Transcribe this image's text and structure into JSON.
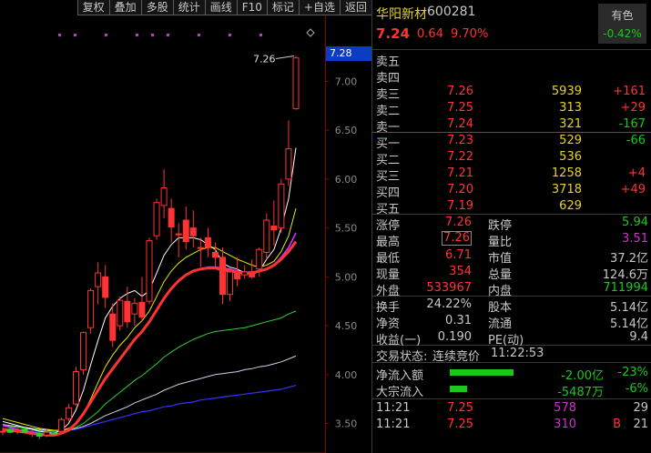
{
  "toolbar": {
    "buttons": [
      "复权",
      "叠加",
      "多股",
      "统计",
      "画线",
      "F10",
      "标记",
      "+自选",
      "返回"
    ]
  },
  "chart": {
    "high_label": "7.26",
    "current_price_tag": "7.28",
    "y_ticks": [
      "7.00",
      "6.50",
      "6.00",
      "5.50",
      "5.00",
      "4.50",
      "4.00",
      "3.50"
    ],
    "colors": {
      "up": "#ff3333",
      "down": "#00c8c8",
      "grid": "#5a0000",
      "ma_white": "#ffffff",
      "ma_yellow": "#e8e800",
      "ma_purple": "#cc33ff",
      "ma_green": "#33cc33",
      "ma_blue": "#3333ff",
      "tag": "#0b3cc4"
    }
  },
  "chart_data": {
    "type": "candlestick",
    "ylim": [
      3.3,
      7.6
    ],
    "candles": [
      {
        "o": 3.42,
        "h": 3.46,
        "l": 3.38,
        "c": 3.42
      },
      {
        "o": 3.44,
        "h": 3.46,
        "l": 3.4,
        "c": 3.41
      },
      {
        "o": 3.42,
        "h": 3.45,
        "l": 3.39,
        "c": 3.43
      },
      {
        "o": 3.44,
        "h": 3.46,
        "l": 3.4,
        "c": 3.41
      },
      {
        "o": 3.4,
        "h": 3.43,
        "l": 3.36,
        "c": 3.4
      },
      {
        "o": 3.4,
        "h": 3.42,
        "l": 3.34,
        "c": 3.37
      },
      {
        "o": 3.38,
        "h": 3.44,
        "l": 3.36,
        "c": 3.41
      },
      {
        "o": 3.4,
        "h": 3.43,
        "l": 3.38,
        "c": 3.39
      },
      {
        "o": 3.42,
        "h": 3.56,
        "l": 3.4,
        "c": 3.54
      },
      {
        "o": 3.55,
        "h": 3.7,
        "l": 3.52,
        "c": 3.66
      },
      {
        "o": 3.7,
        "h": 4.08,
        "l": 3.68,
        "c": 4.03
      },
      {
        "o": 4.05,
        "h": 4.44,
        "l": 4.0,
        "c": 4.43
      },
      {
        "o": 4.48,
        "h": 4.88,
        "l": 4.42,
        "c": 4.86
      },
      {
        "o": 4.9,
        "h": 5.15,
        "l": 4.72,
        "c": 5.04
      },
      {
        "o": 5.0,
        "h": 5.12,
        "l": 4.68,
        "c": 4.79
      },
      {
        "o": 4.62,
        "h": 4.73,
        "l": 4.28,
        "c": 4.35
      },
      {
        "o": 4.5,
        "h": 4.8,
        "l": 4.45,
        "c": 4.76
      },
      {
        "o": 4.75,
        "h": 4.9,
        "l": 4.48,
        "c": 4.54
      },
      {
        "o": 4.62,
        "h": 4.78,
        "l": 4.5,
        "c": 4.73
      },
      {
        "o": 4.74,
        "h": 5.0,
        "l": 4.55,
        "c": 4.59
      },
      {
        "o": 4.75,
        "h": 5.4,
        "l": 4.72,
        "c": 5.37
      },
      {
        "o": 5.42,
        "h": 5.8,
        "l": 5.38,
        "c": 5.76
      },
      {
        "o": 5.73,
        "h": 6.1,
        "l": 5.6,
        "c": 5.91
      },
      {
        "o": 5.7,
        "h": 5.8,
        "l": 5.35,
        "c": 5.51
      },
      {
        "o": 5.44,
        "h": 5.55,
        "l": 5.2,
        "c": 5.43
      },
      {
        "o": 5.58,
        "h": 5.72,
        "l": 5.28,
        "c": 5.36
      },
      {
        "o": 5.5,
        "h": 5.68,
        "l": 5.3,
        "c": 5.42
      },
      {
        "o": 5.3,
        "h": 5.4,
        "l": 5.1,
        "c": 5.3
      },
      {
        "o": 5.4,
        "h": 5.5,
        "l": 5.2,
        "c": 5.3
      },
      {
        "o": 5.25,
        "h": 5.35,
        "l": 5.1,
        "c": 5.2
      },
      {
        "o": 5.2,
        "h": 5.3,
        "l": 4.72,
        "c": 4.82
      },
      {
        "o": 4.82,
        "h": 5.1,
        "l": 4.75,
        "c": 5.05
      },
      {
        "o": 5.05,
        "h": 5.2,
        "l": 4.9,
        "c": 4.98
      },
      {
        "o": 5.02,
        "h": 5.12,
        "l": 4.98,
        "c": 5.05
      },
      {
        "o": 5.04,
        "h": 5.18,
        "l": 4.98,
        "c": 5.0
      },
      {
        "o": 5.08,
        "h": 5.3,
        "l": 5.0,
        "c": 5.28
      },
      {
        "o": 5.25,
        "h": 5.65,
        "l": 5.18,
        "c": 5.58
      },
      {
        "o": 5.52,
        "h": 5.78,
        "l": 5.32,
        "c": 5.48
      },
      {
        "o": 5.5,
        "h": 6.0,
        "l": 5.45,
        "c": 5.95
      },
      {
        "o": 6.0,
        "h": 6.6,
        "l": 5.93,
        "c": 6.31
      },
      {
        "o": 6.72,
        "h": 7.26,
        "l": 6.71,
        "c": 7.24
      }
    ],
    "ma_white": [
      3.52,
      3.5,
      3.48,
      3.46,
      3.44,
      3.42,
      3.41,
      3.4,
      3.43,
      3.5,
      3.64,
      3.84,
      4.1,
      4.35,
      4.58,
      4.7,
      4.78,
      4.83,
      4.86,
      4.8,
      4.86,
      5.04,
      5.22,
      5.33,
      5.4,
      5.4,
      5.4,
      5.38,
      5.33,
      5.28,
      5.14,
      5.1,
      5.08,
      5.04,
      5.02,
      5.06,
      5.18,
      5.28,
      5.5,
      5.8,
      6.32
    ],
    "ma_yellow": [
      3.55,
      3.53,
      3.51,
      3.49,
      3.47,
      3.45,
      3.44,
      3.43,
      3.43,
      3.45,
      3.5,
      3.6,
      3.75,
      3.92,
      4.08,
      4.2,
      4.3,
      4.38,
      4.48,
      4.55,
      4.65,
      4.8,
      4.95,
      5.06,
      5.14,
      5.2,
      5.24,
      5.28,
      5.3,
      5.3,
      5.26,
      5.22,
      5.18,
      5.15,
      5.12,
      5.1,
      5.12,
      5.16,
      5.26,
      5.42,
      5.7
    ],
    "ma_purple": [
      3.48,
      3.46,
      3.44,
      3.42,
      3.41,
      3.4,
      3.39,
      3.39,
      3.4,
      3.43,
      3.5,
      3.6,
      3.72,
      3.84,
      3.96,
      4.06,
      4.16,
      4.26,
      4.36,
      4.44,
      4.54,
      4.66,
      4.78,
      4.88,
      4.96,
      5.02,
      5.06,
      5.08,
      5.1,
      5.1,
      5.09,
      5.08,
      5.06,
      5.05,
      5.05,
      5.06,
      5.08,
      5.12,
      5.2,
      5.3,
      5.45
    ],
    "ma_red": [
      3.44,
      3.43,
      3.42,
      3.41,
      3.4,
      3.39,
      3.38,
      3.38,
      3.4,
      3.43,
      3.5,
      3.6,
      3.72,
      3.84,
      3.96,
      4.06,
      4.16,
      4.26,
      4.36,
      4.44,
      4.54,
      4.66,
      4.78,
      4.88,
      4.96,
      5.02,
      5.06,
      5.08,
      5.09,
      5.09,
      5.07,
      5.06,
      5.05,
      5.04,
      5.04,
      5.06,
      5.08,
      5.12,
      5.18,
      5.26,
      5.36
    ],
    "ma_green": [
      3.48,
      3.47,
      3.46,
      3.45,
      3.44,
      3.43,
      3.42,
      3.42,
      3.42,
      3.43,
      3.46,
      3.5,
      3.56,
      3.62,
      3.7,
      3.76,
      3.82,
      3.88,
      3.94,
      3.99,
      4.05,
      4.11,
      4.18,
      4.23,
      4.28,
      4.32,
      4.36,
      4.39,
      4.42,
      4.44,
      4.45,
      4.46,
      4.47,
      4.48,
      4.5,
      4.52,
      4.54,
      4.56,
      4.58,
      4.62,
      4.65
    ],
    "ma_lavender": [
      3.49,
      3.48,
      3.47,
      3.46,
      3.45,
      3.44,
      3.43,
      3.43,
      3.43,
      3.43,
      3.45,
      3.47,
      3.5,
      3.54,
      3.58,
      3.61,
      3.64,
      3.67,
      3.71,
      3.74,
      3.77,
      3.8,
      3.84,
      3.87,
      3.9,
      3.92,
      3.94,
      3.96,
      3.98,
      4.0,
      4.01,
      4.02,
      4.03,
      4.05,
      4.06,
      4.08,
      4.09,
      4.11,
      4.13,
      4.16,
      4.19
    ],
    "ma_blue": [
      3.44,
      3.44,
      3.43,
      3.43,
      3.42,
      3.42,
      3.42,
      3.42,
      3.42,
      3.43,
      3.44,
      3.46,
      3.48,
      3.5,
      3.52,
      3.54,
      3.56,
      3.58,
      3.6,
      3.62,
      3.63,
      3.65,
      3.67,
      3.68,
      3.7,
      3.71,
      3.72,
      3.74,
      3.75,
      3.76,
      3.77,
      3.78,
      3.79,
      3.8,
      3.81,
      3.82,
      3.83,
      3.84,
      3.85,
      3.87,
      3.89
    ],
    "marker_dots": [
      2,
      3,
      5,
      7,
      8,
      9,
      11,
      13,
      15
    ]
  },
  "quote": {
    "name": "华阳新材",
    "code": "600281",
    "price": "7.24",
    "change": "0.64",
    "change_pct": "9.70%",
    "sector": {
      "name": "有色",
      "pct": "-0.42%"
    }
  },
  "asks": [
    {
      "label": "卖五",
      "price": "",
      "vol": "",
      "delta": "",
      "delta_color": ""
    },
    {
      "label": "卖四",
      "price": "",
      "vol": "",
      "delta": "",
      "delta_color": ""
    },
    {
      "label": "卖三",
      "price": "7.26",
      "vol": "5939",
      "delta": "+161",
      "delta_color": "red"
    },
    {
      "label": "卖二",
      "price": "7.25",
      "vol": "313",
      "delta": "+29",
      "delta_color": "red"
    },
    {
      "label": "卖一",
      "price": "7.24",
      "vol": "321",
      "delta": "-167",
      "delta_color": "green"
    }
  ],
  "bids": [
    {
      "label": "买一",
      "price": "7.23",
      "vol": "529",
      "delta": "-66",
      "delta_color": "green"
    },
    {
      "label": "买二",
      "price": "7.22",
      "vol": "536",
      "delta": "",
      "delta_color": ""
    },
    {
      "label": "买三",
      "price": "7.21",
      "vol": "1258",
      "delta": "+4",
      "delta_color": "red"
    },
    {
      "label": "买四",
      "price": "7.20",
      "vol": "3718",
      "delta": "+49",
      "delta_color": "red"
    },
    {
      "label": "买五",
      "price": "7.19",
      "vol": "629",
      "delta": "",
      "delta_color": ""
    }
  ],
  "stats1": [
    {
      "l1": "涨停",
      "v1": "7.26",
      "c1": "red",
      "l2": "跌停",
      "v2": "5.94",
      "c2": "green"
    },
    {
      "l1": "最高",
      "v1": "7.26",
      "c1": "red",
      "boxed": true,
      "l2": "量比",
      "v2": "3.51",
      "c2": "purple"
    },
    {
      "l1": "最低",
      "v1": "6.71",
      "c1": "red",
      "l2": "市值",
      "v2": "37.2亿",
      "c2": "white"
    },
    {
      "l1": "现量",
      "v1": "354",
      "c1": "red",
      "l2": "总量",
      "v2": "124.6万",
      "c2": "white"
    },
    {
      "l1": "外盘",
      "v1": "533967",
      "c1": "red",
      "l2": "内盘",
      "v2": "711994",
      "c2": "green"
    }
  ],
  "stats2": [
    {
      "l1": "换手",
      "v1": "24.22%",
      "c1": "white",
      "l2": "股本",
      "v2": "5.14亿",
      "c2": "white"
    },
    {
      "l1": "净资",
      "v1": "0.31",
      "c1": "white",
      "l2": "流通",
      "v2": "5.14亿",
      "c2": "white"
    },
    {
      "l1": "收益(一)",
      "v1": "0.190",
      "c1": "white",
      "l2": "PE(动)",
      "v2": "9.4",
      "c2": "white"
    }
  ],
  "trade_status": {
    "label": "交易状态:",
    "value": "连续竞价",
    "time": "11:22:53"
  },
  "flows": [
    {
      "label": "净流入额",
      "value": "-2.00亿",
      "pct": "-23%",
      "level": 1.0
    },
    {
      "label": "大宗流入",
      "value": "-5487万",
      "pct": "-6%",
      "level": 0.27
    }
  ],
  "ticks": [
    {
      "time": "11:21",
      "price": "7.25",
      "vol": "578",
      "flag": "",
      "count": "29"
    },
    {
      "time": "11:21",
      "price": "7.25",
      "vol": "310",
      "flag": "B",
      "count": "21"
    }
  ]
}
